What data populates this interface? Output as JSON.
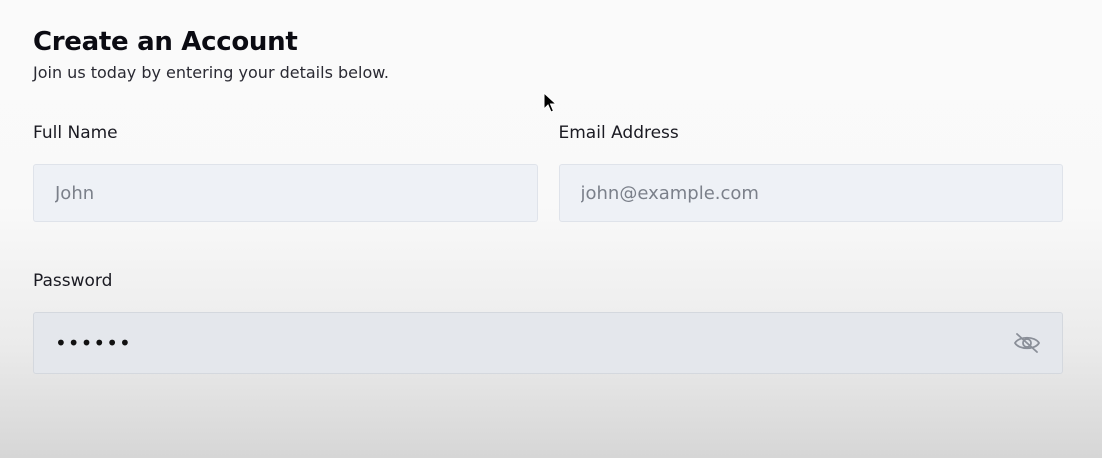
{
  "header": {
    "title": "Create an Account",
    "subtitle": "Join us today by entering your details below."
  },
  "form": {
    "full_name": {
      "label": "Full Name",
      "placeholder": "John",
      "value": ""
    },
    "email": {
      "label": "Email Address",
      "placeholder": "john@example.com",
      "value": ""
    },
    "password": {
      "label": "Password",
      "value": "••••••",
      "toggle_icon": "eye-slash-icon"
    }
  }
}
